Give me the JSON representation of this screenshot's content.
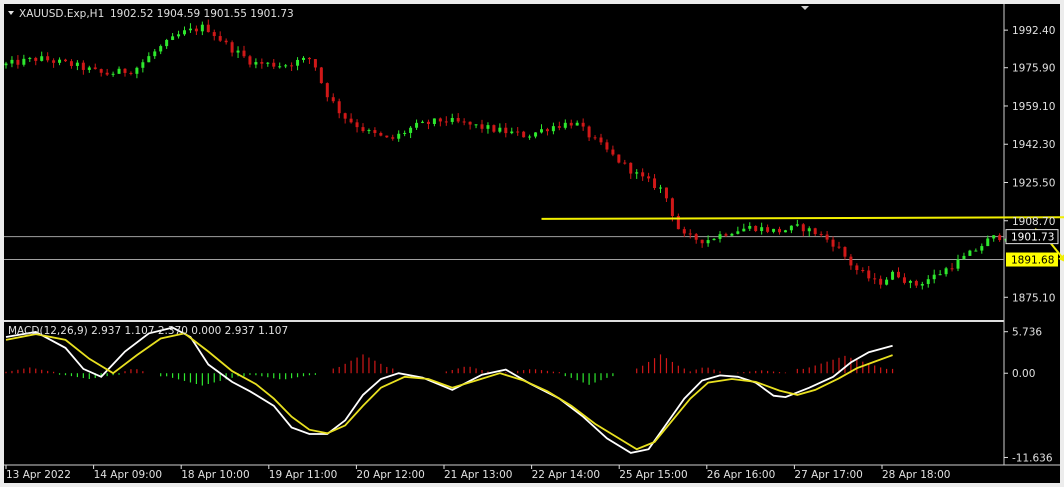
{
  "header": {
    "symbol": "XAUUSD.Exp,H1",
    "ohlc": "1902.52 1904.59 1901.55 1901.73"
  },
  "indicator": {
    "label": "MACD(12,26,9) 2.937 1.107 2.370 0.000 2.937 1.107"
  },
  "colors": {
    "background": "#000000",
    "bull": "#2ee82e",
    "bear": "#d01818",
    "macd_line": "#ffffff",
    "signal_line": "#e8e020",
    "annotation": "#f2f000",
    "level_line": "#a0a0a0",
    "axis_text": "#e0e0e0",
    "highlight_label": "#ffff00"
  },
  "chart_data": [
    {
      "type": "candlestick",
      "series_name": "XAUUSD.Exp,H1",
      "yticks": [
        "1992.40",
        "1975.90",
        "1959.10",
        "1942.30",
        "1925.50",
        "1908.70",
        "1875.10"
      ],
      "ytick_values": [
        1992.4,
        1975.9,
        1959.1,
        1942.3,
        1925.5,
        1908.7,
        1875.1
      ],
      "ylim": [
        1866.0,
        2003.0
      ],
      "current_price": "1901.73",
      "current_price_value": 1901.73,
      "level_label": "1891.68",
      "level_value": 1891.68,
      "xticks": [
        "13 Apr 2022",
        "14 Apr 09:00",
        "18 Apr 10:00",
        "19 Apr 11:00",
        "20 Apr 12:00",
        "21 Apr 13:00",
        "22 Apr 14:00",
        "25 Apr 15:00",
        "26 Apr 16:00",
        "27 Apr 17:00",
        "28 Apr 18:00"
      ],
      "bar_count": 152,
      "price_path": [
        [
          0,
          1977
        ],
        [
          6,
          1980
        ],
        [
          12,
          1977
        ],
        [
          17,
          1973
        ],
        [
          22,
          1975
        ],
        [
          26,
          1984
        ],
        [
          30,
          1991
        ],
        [
          34,
          1994
        ],
        [
          38,
          1985
        ],
        [
          42,
          1978
        ],
        [
          47,
          1977
        ],
        [
          50,
          1979
        ],
        [
          52,
          1980
        ],
        [
          54,
          1966
        ],
        [
          57,
          1955
        ],
        [
          61,
          1948
        ],
        [
          65,
          1944
        ],
        [
          69,
          1950
        ],
        [
          74,
          1953
        ],
        [
          80,
          1950
        ],
        [
          84,
          1948
        ],
        [
          88,
          1946
        ],
        [
          92,
          1950
        ],
        [
          96,
          1952
        ],
        [
          99,
          1945
        ],
        [
          103,
          1936
        ],
        [
          107,
          1928
        ],
        [
          111,
          1922
        ],
        [
          114,
          1902
        ],
        [
          118,
          1900
        ],
        [
          122,
          1904
        ],
        [
          126,
          1906
        ],
        [
          130,
          1904
        ],
        [
          134,
          1906
        ],
        [
          137,
          1903
        ],
        [
          140,
          1898
        ],
        [
          143,
          1888
        ],
        [
          147,
          1881
        ],
        [
          150,
          1886
        ],
        [
          153,
          1880
        ],
        [
          157,
          1885
        ],
        [
          160,
          1890
        ],
        [
          163,
          1895
        ],
        [
          166,
          1901
        ],
        [
          168,
          1902
        ]
      ],
      "annotation_arrows": [
        {
          "type": "horizontal",
          "from": [
            90,
            1909.5
          ],
          "to": [
            210,
            1910.5
          ]
        },
        {
          "type": "path",
          "points": [
            [
              168,
              1902
            ],
            [
              174,
              1904
            ],
            [
              178,
              1891
            ],
            [
              183,
              1904
            ],
            [
              190,
              1892
            ],
            [
              197,
              1880
            ]
          ]
        }
      ]
    },
    {
      "type": "line",
      "series_name": "MACD(12,26,9)",
      "yticks": [
        "5.736",
        "0.00",
        "-11.636"
      ],
      "ytick_values": [
        5.736,
        0.0,
        -11.636
      ],
      "ylim": [
        -12.4,
        6.8
      ],
      "series": [
        {
          "name": "",
          "role": "macd",
          "points": [
            [
              0,
              5
            ],
            [
              5,
              5.7
            ],
            [
              10,
              3.5
            ],
            [
              13,
              0.6
            ],
            [
              16,
              -0.5
            ],
            [
              20,
              3
            ],
            [
              24,
              5.5
            ],
            [
              28,
              6.3
            ],
            [
              31,
              5
            ],
            [
              34,
              1.2
            ],
            [
              38,
              -1.2
            ],
            [
              41,
              -2.5
            ],
            [
              45,
              -4.5
            ],
            [
              48,
              -7.5
            ],
            [
              51,
              -8.4
            ],
            [
              54,
              -8.4
            ],
            [
              57,
              -6.5
            ],
            [
              60,
              -3
            ],
            [
              63,
              -0.8
            ],
            [
              66,
              0
            ],
            [
              70,
              -0.6
            ],
            [
              75,
              -2.3
            ],
            [
              80,
              -0.2
            ],
            [
              84,
              0.5
            ],
            [
              88,
              -1.4
            ],
            [
              93,
              -3.5
            ],
            [
              97,
              -6
            ],
            [
              101,
              -9
            ],
            [
              105,
              -11
            ],
            [
              108,
              -10.5
            ],
            [
              111,
              -7
            ],
            [
              114,
              -3.5
            ],
            [
              117,
              -1
            ],
            [
              120,
              -0.3
            ],
            [
              123,
              -0.5
            ],
            [
              126,
              -1.3
            ],
            [
              129,
              -3.1
            ],
            [
              131,
              -3.3
            ],
            [
              135,
              -2
            ],
            [
              139,
              -0.5
            ],
            [
              142,
              1.5
            ],
            [
              145,
              2.9
            ],
            [
              149,
              3.8
            ]
          ]
        },
        {
          "name": "",
          "role": "signal",
          "points": [
            [
              0,
              4.6
            ],
            [
              5,
              5.4
            ],
            [
              10,
              4.6
            ],
            [
              14,
              2
            ],
            [
              18,
              0
            ],
            [
              22,
              2.5
            ],
            [
              26,
              4.8
            ],
            [
              30,
              5.5
            ],
            [
              34,
              3
            ],
            [
              38,
              0.3
            ],
            [
              42,
              -1.5
            ],
            [
              45,
              -3.5
            ],
            [
              48,
              -6
            ],
            [
              51,
              -7.8
            ],
            [
              54,
              -8.3
            ],
            [
              57,
              -7.2
            ],
            [
              60,
              -4.5
            ],
            [
              63,
              -2
            ],
            [
              67,
              -0.5
            ],
            [
              71,
              -0.8
            ],
            [
              75,
              -2
            ],
            [
              79,
              -1
            ],
            [
              83,
              0
            ],
            [
              87,
              -1
            ],
            [
              91,
              -2.5
            ],
            [
              95,
              -4.5
            ],
            [
              99,
              -7
            ],
            [
              103,
              -9
            ],
            [
              106,
              -10.5
            ],
            [
              109,
              -9.5
            ],
            [
              112,
              -6.5
            ],
            [
              115,
              -3.5
            ],
            [
              118,
              -1.3
            ],
            [
              122,
              -0.8
            ],
            [
              126,
              -1.2
            ],
            [
              130,
              -2.4
            ],
            [
              133,
              -3
            ],
            [
              136,
              -2.3
            ],
            [
              140,
              -0.7
            ],
            [
              143,
              0.7
            ],
            [
              146,
              1.6
            ],
            [
              149,
              2.5
            ]
          ]
        }
      ],
      "histogram": [
        {
          "from": 0,
          "to": 8,
          "value": 0.8
        },
        {
          "from": 9,
          "to": 19,
          "value": -0.8
        },
        {
          "from": 20,
          "to": 23,
          "value": 0.7
        },
        {
          "from": 26,
          "to": 40,
          "value": -1.7
        },
        {
          "from": 41,
          "to": 52,
          "value": -0.9
        },
        {
          "from": 55,
          "to": 65,
          "value": 2.6
        },
        {
          "from": 74,
          "to": 81,
          "value": 1.0
        },
        {
          "from": 84,
          "to": 93,
          "value": 0.6
        },
        {
          "from": 94,
          "to": 102,
          "value": -1.6
        },
        {
          "from": 106,
          "to": 114,
          "value": 2.6
        },
        {
          "from": 115,
          "to": 120,
          "value": 0.9
        },
        {
          "from": 123,
          "to": 131,
          "value": 0.4
        },
        {
          "from": 133,
          "to": 149,
          "value": 2.4
        }
      ]
    }
  ]
}
